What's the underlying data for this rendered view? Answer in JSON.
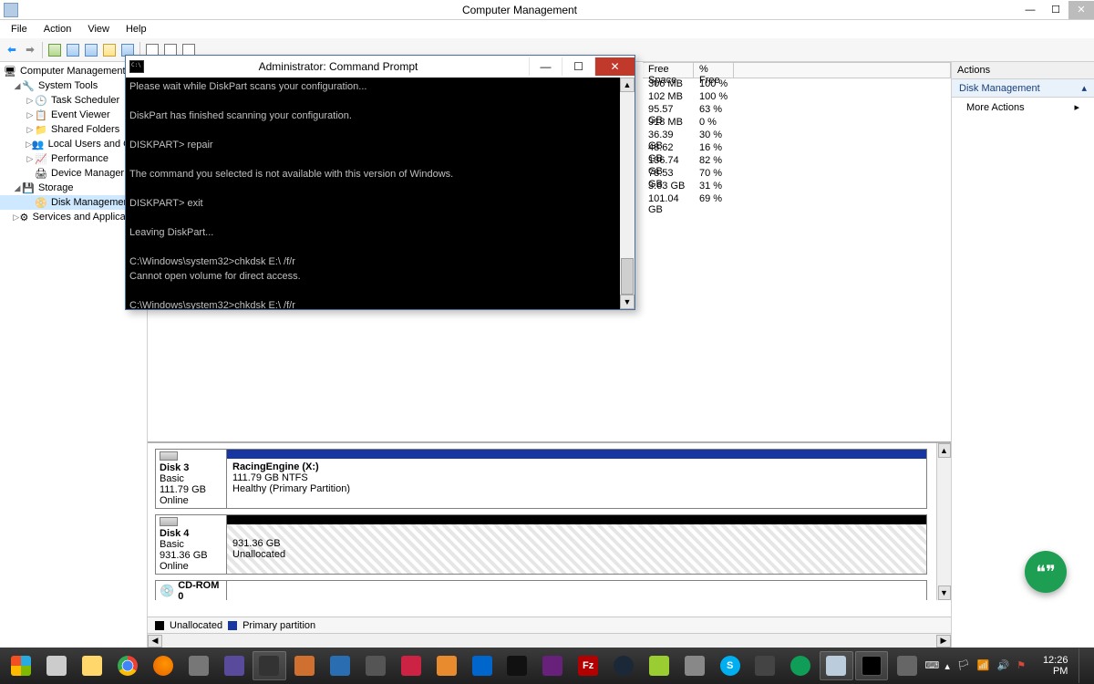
{
  "window": {
    "title": "Computer Management",
    "menus": [
      "File",
      "Action",
      "View",
      "Help"
    ]
  },
  "tree": {
    "root": "Computer Management (Local)",
    "system_tools": "System Tools",
    "items_st": [
      "Task Scheduler",
      "Event Viewer",
      "Shared Folders",
      "Local Users and Groups",
      "Performance",
      "Device Manager"
    ],
    "storage": "Storage",
    "disk_mgmt": "Disk Management",
    "services": "Services and Applications"
  },
  "volume_list": {
    "headers": {
      "free": "Free Space",
      "pct": "% Free"
    },
    "rows": [
      {
        "free": "306 MB",
        "pct": "100 %"
      },
      {
        "free": "102 MB",
        "pct": "100 %"
      },
      {
        "free": "95.57 GB",
        "pct": "63 %"
      },
      {
        "free": "918 MB",
        "pct": "0 %"
      },
      {
        "free": "36.39 GB",
        "pct": "30 %"
      },
      {
        "free": "48.62 GB",
        "pct": "16 %"
      },
      {
        "free": "136.74 GB",
        "pct": "82 %"
      },
      {
        "free": "78.53 GB",
        "pct": "70 %"
      },
      {
        "free": "3.63 GB",
        "pct": "31 %"
      },
      {
        "free": "101.04 GB",
        "pct": "69 %"
      }
    ]
  },
  "disks": {
    "d3": {
      "label": "Disk 3",
      "type": "Basic",
      "size": "111.79 GB",
      "status": "Online",
      "vol_name": "RacingEngine  (X:)",
      "vol_size": "111.79 GB NTFS",
      "vol_health": "Healthy (Primary Partition)"
    },
    "d4": {
      "label": "Disk 4",
      "type": "Basic",
      "size": "931.36 GB",
      "status": "Online",
      "vol_size": "931.36 GB",
      "vol_state": "Unallocated"
    },
    "cd": {
      "label": "CD-ROM 0"
    },
    "legend": {
      "unalloc": "Unallocated",
      "primary": "Primary partition"
    }
  },
  "actions": {
    "header": "Actions",
    "category": "Disk Management",
    "more": "More Actions"
  },
  "cmd": {
    "title": "Administrator: Command Prompt",
    "lines": "Please wait while DiskPart scans your configuration...\n\nDiskPart has finished scanning your configuration.\n\nDISKPART> repair\n\nThe command you selected is not available with this version of Windows.\n\nDISKPART> exit\n\nLeaving DiskPart...\n\nC:\\Windows\\system32>chkdsk E:\\ /f/r\nCannot open volume for direct access.\n\nC:\\Windows\\system32>chkdsk E:\\ /f/r\nCannot open volume for direct access.\n\nC:\\Windows\\system32>chkdsk E:\\ /f\nCannot open volume for direct access.\n\nC:\\Windows\\system32>chkdsk E:\\\nCannot open volume for direct access.\n\nC:\\Windows\\system32>"
  },
  "taskbar": {
    "time": "12:26 PM",
    "tray_up": "▴"
  }
}
